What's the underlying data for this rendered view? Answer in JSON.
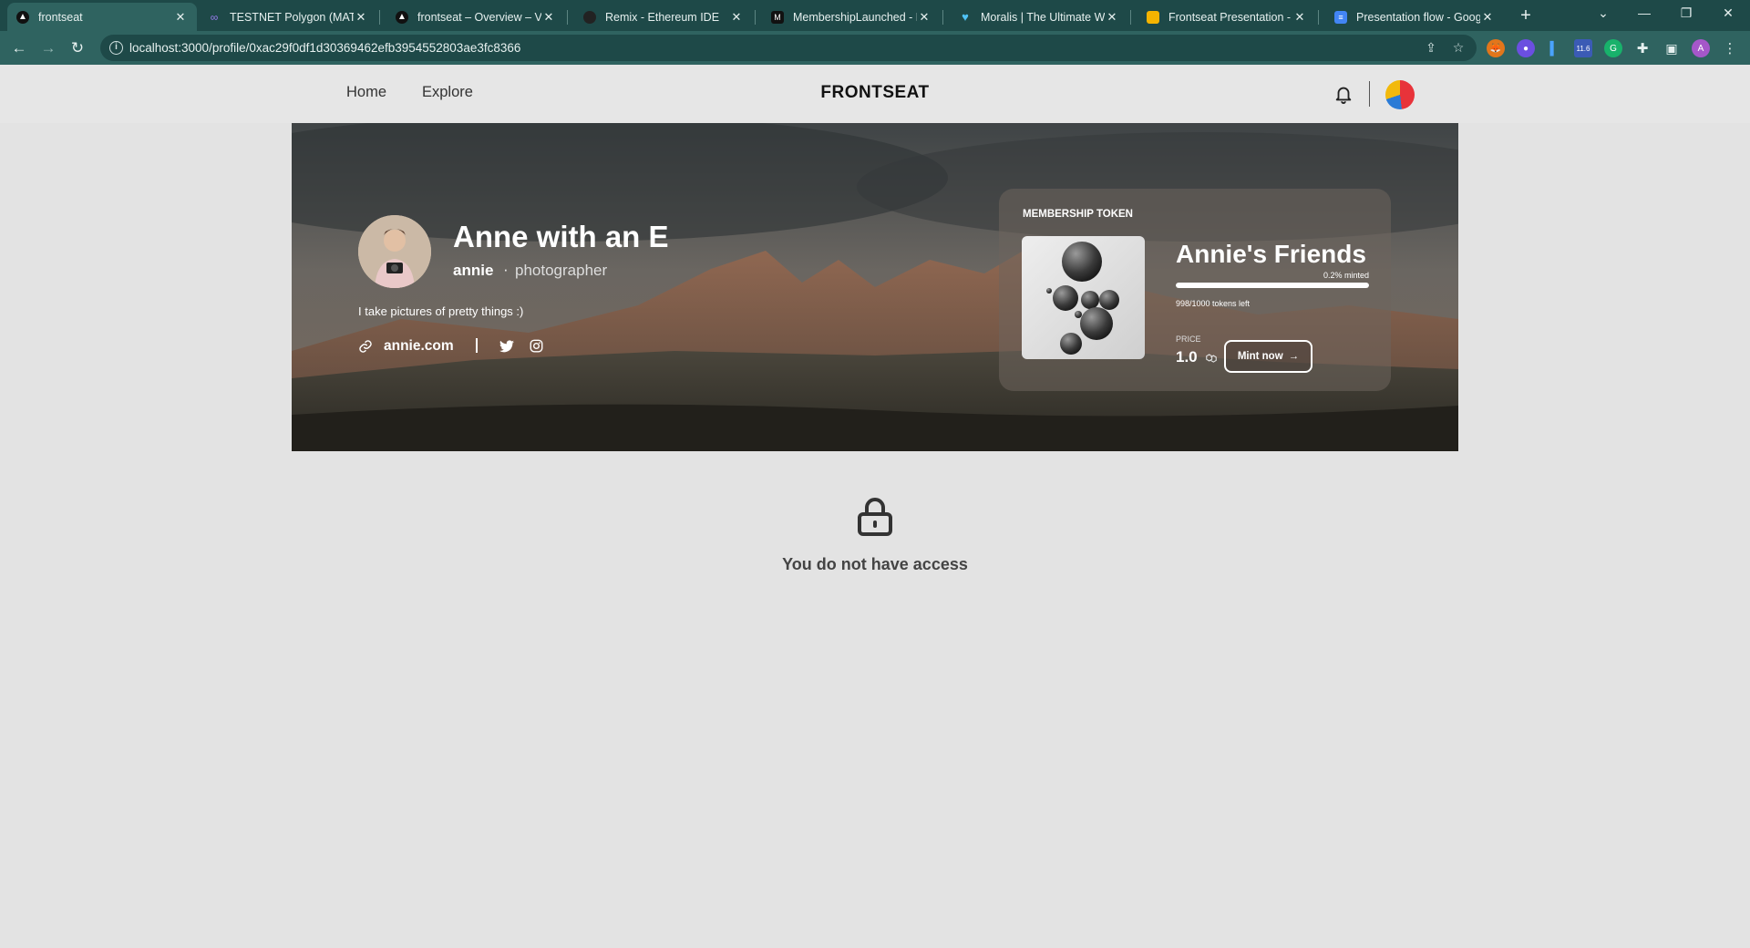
{
  "browser": {
    "tabs": [
      {
        "title": "frontseat",
        "favicon": "triangle-icon",
        "active": true
      },
      {
        "title": "TESTNET Polygon (MATIC)",
        "favicon": "polygon-icon"
      },
      {
        "title": "frontseat – Overview – Ver",
        "favicon": "triangle-icon"
      },
      {
        "title": "Remix - Ethereum IDE",
        "favicon": "remix-icon"
      },
      {
        "title": "MembershipLaunched - M",
        "favicon": "moralis-icon"
      },
      {
        "title": "Moralis | The Ultimate Wel",
        "favicon": "moralis-icon"
      },
      {
        "title": "Frontseat Presentation - G",
        "favicon": "slides-icon"
      },
      {
        "title": "Presentation flow - Google",
        "favicon": "docs-icon"
      }
    ],
    "url": "localhost:3000/profile/0xac29f0df1d30369462efb3954552803ae3fc8366",
    "extension_badge": "11.6"
  },
  "header": {
    "nav": [
      "Home",
      "Explore"
    ],
    "logo": "FRONTSEAT"
  },
  "profile": {
    "display_name": "Anne with an E",
    "username": "annie",
    "separator": "·",
    "role": "photographer",
    "bio": "I take pictures of pretty things :)",
    "website": "annie.com"
  },
  "membership": {
    "label": "MEMBERSHIP TOKEN",
    "name": "Annie's Friends",
    "minted_text": "0.2% minted",
    "minted_fraction": 0.002,
    "tokens_left_text": "998/1000 tokens left",
    "price_label": "PRICE",
    "price": "1.0",
    "mint_button": "Mint now",
    "mint_arrow": "→"
  },
  "access": {
    "message": "You do not have access"
  },
  "colors": {
    "tabbar": "#1e4948",
    "toolbar": "#2f6360",
    "page_bg": "#e3e3e3"
  }
}
